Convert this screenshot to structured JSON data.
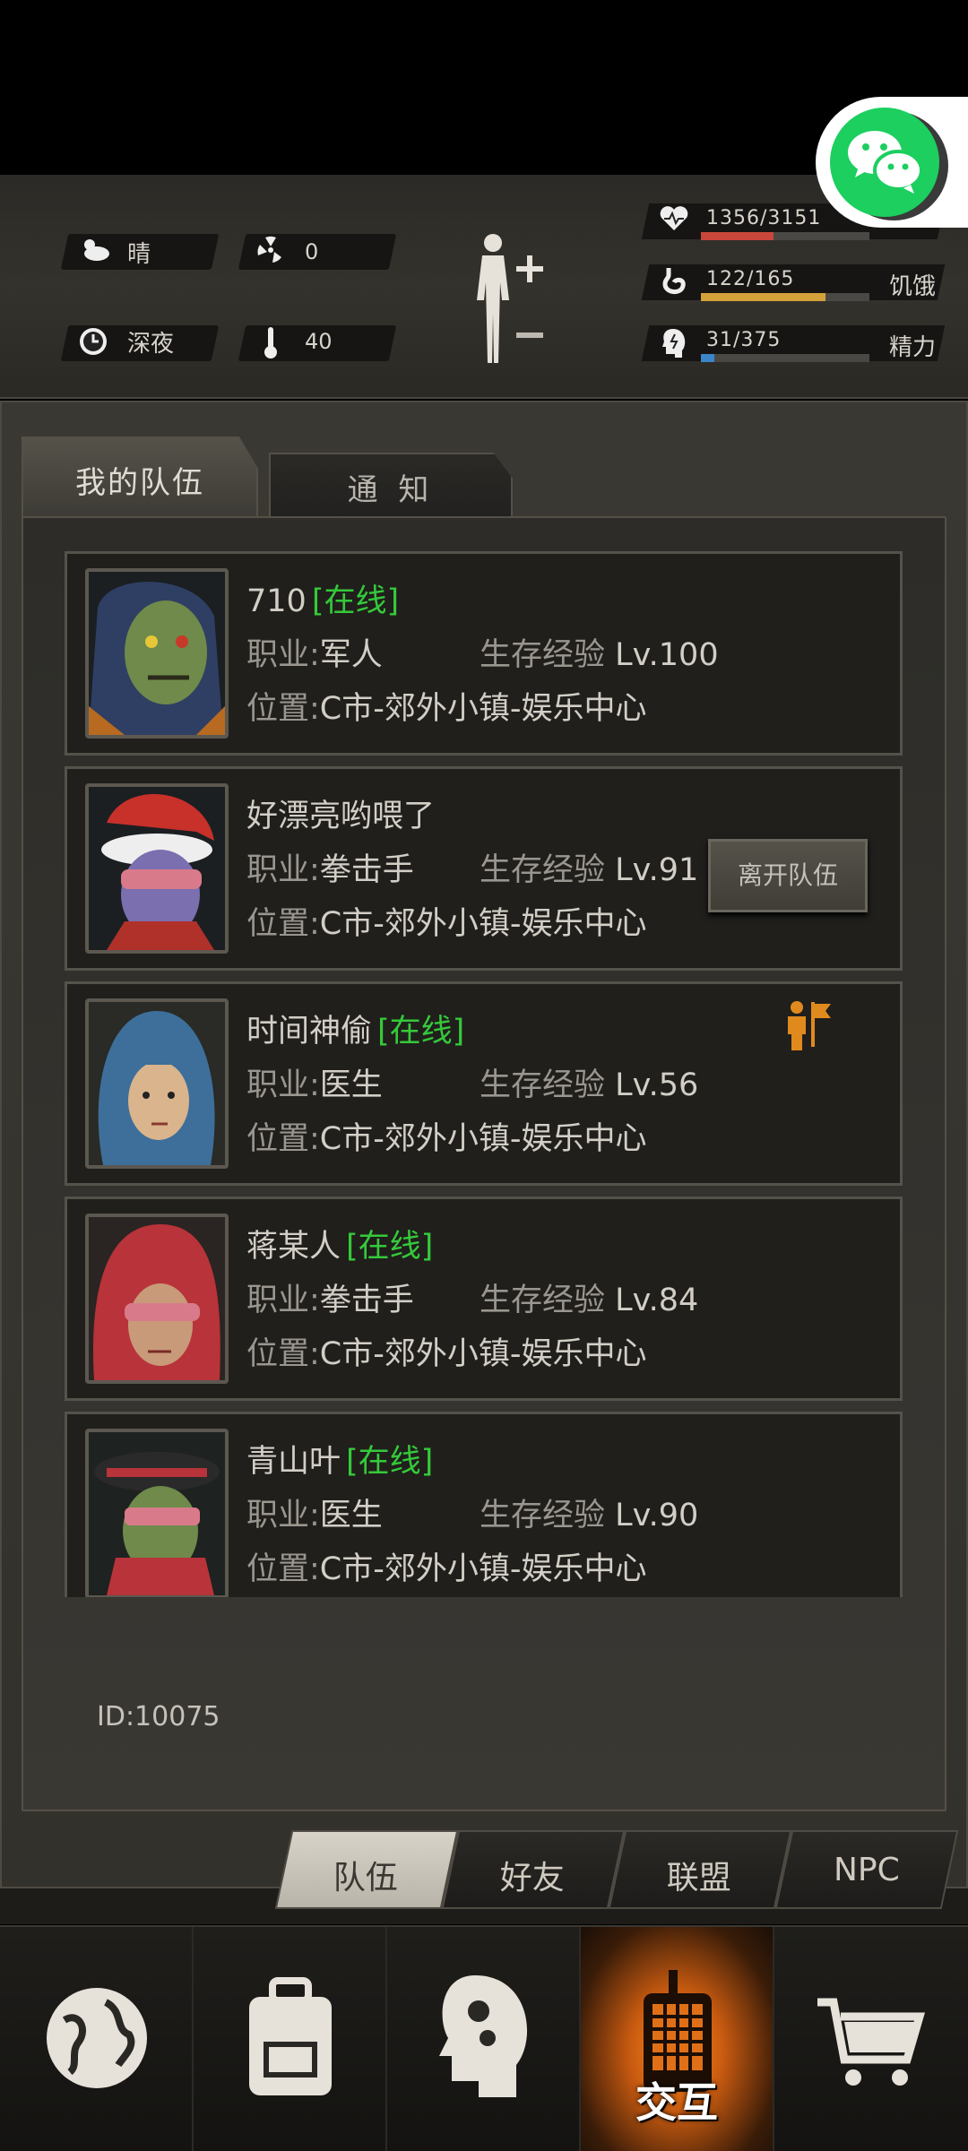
{
  "status": {
    "weather": "晴",
    "radiation": "0",
    "time_of_day": "深夜",
    "temperature": "40",
    "health": {
      "value": "1356/3151",
      "label": "",
      "fraction": 0.43,
      "color": "#c9473a"
    },
    "hunger": {
      "value": "122/165",
      "label": "饥饿",
      "fraction": 0.74,
      "color": "#d3a13a"
    },
    "energy": {
      "value": "31/375",
      "label": "精力",
      "fraction": 0.08,
      "color": "#3a86c9"
    }
  },
  "tabs": {
    "my_team": "我的队伍",
    "notice": "通 知"
  },
  "members": [
    {
      "name": "710",
      "online": "[在线]",
      "job_label": "职业:",
      "job": "军人",
      "exp_label": "生存经验",
      "level": "Lv.100",
      "loc_label": "位置:",
      "location": "C市-郊外小镇-娱乐中心"
    },
    {
      "name": "好漂亮哟喂了",
      "online": "",
      "job_label": "职业:",
      "job": "拳击手",
      "exp_label": "生存经验",
      "level": "Lv.91",
      "loc_label": "位置:",
      "location": "C市-郊外小镇-娱乐中心",
      "button": "离开队伍"
    },
    {
      "name": "时间神偷",
      "online": "[在线]",
      "job_label": "职业:",
      "job": "医生",
      "exp_label": "生存经验",
      "level": "Lv.56",
      "loc_label": "位置:",
      "location": "C市-郊外小镇-娱乐中心"
    },
    {
      "name": "蒋某人",
      "online": "[在线]",
      "job_label": "职业:",
      "job": "拳击手",
      "exp_label": "生存经验",
      "level": "Lv.84",
      "loc_label": "位置:",
      "location": "C市-郊外小镇-娱乐中心"
    },
    {
      "name": "青山叶",
      "online": "[在线]",
      "job_label": "职业:",
      "job": "医生",
      "exp_label": "生存经验",
      "level": "Lv.90",
      "loc_label": "位置:",
      "location": "C市-郊外小镇-娱乐中心"
    }
  ],
  "player_id": "ID:10075",
  "subtabs": [
    "队伍",
    "好友",
    "联盟",
    "NPC"
  ],
  "nav": {
    "interact_label": "交互"
  },
  "icons": [
    "weather-sun-cloud-icon",
    "radiation-icon",
    "clock-icon",
    "thermometer-icon",
    "heart-icon",
    "stomach-icon",
    "brain-icon",
    "body-figure-icon",
    "wechat-icon",
    "leader-flag-icon",
    "globe-icon",
    "backpack-icon",
    "head-gears-icon",
    "walkie-talkie-icon",
    "cart-icon"
  ]
}
